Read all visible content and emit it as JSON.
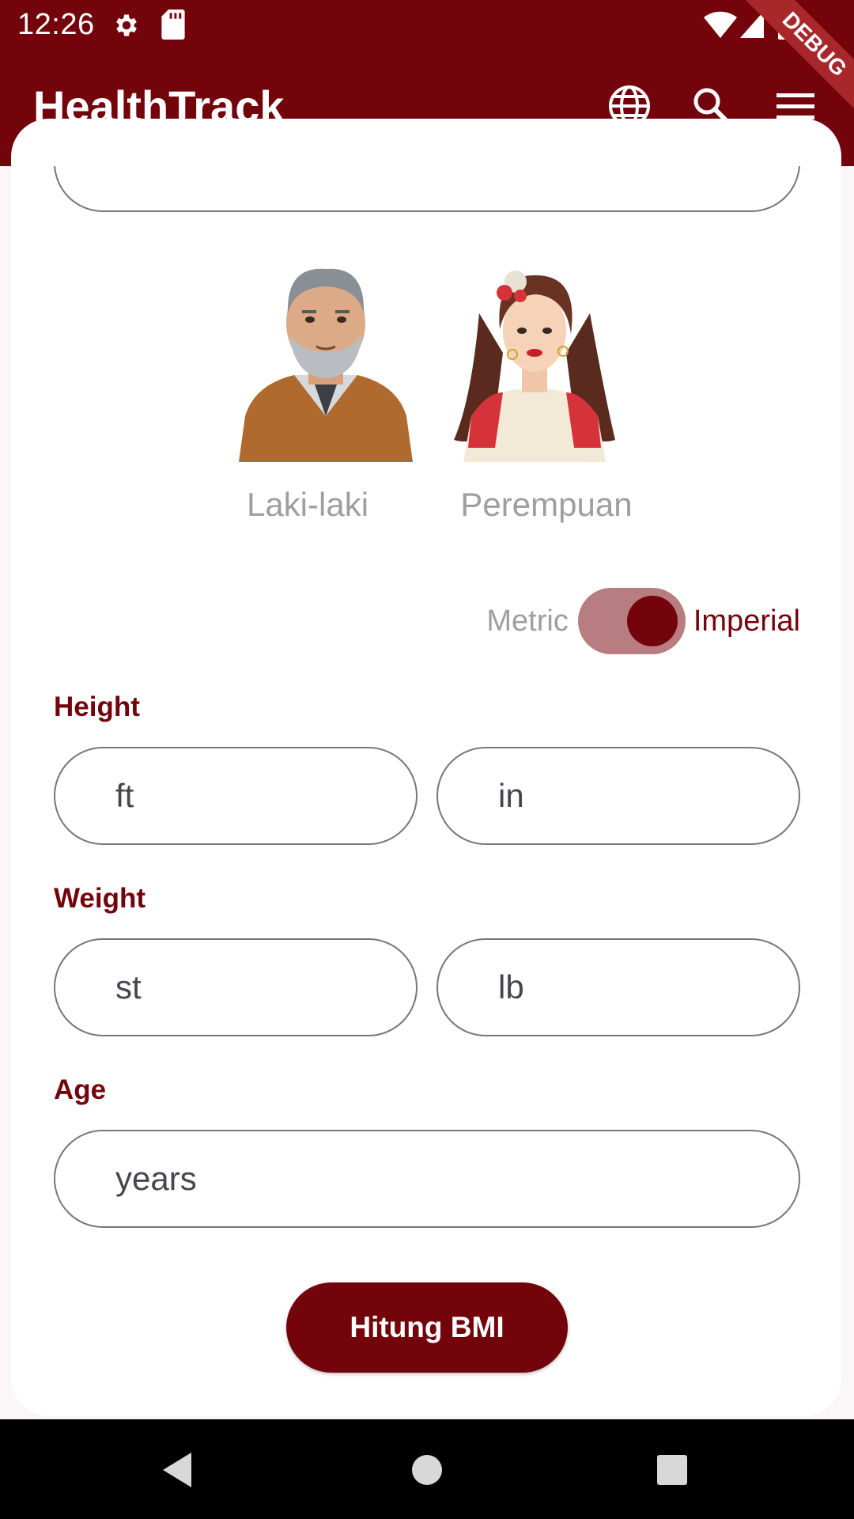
{
  "status_bar": {
    "time": "12:26"
  },
  "app_bar": {
    "title": "HealthTrack"
  },
  "debug_banner": "DEBUG",
  "gender": {
    "male_label": "Laki-laki",
    "female_label": "Perempuan"
  },
  "units": {
    "metric_label": "Metric",
    "imperial_label": "Imperial",
    "selected": "Imperial"
  },
  "form": {
    "height_label": "Height",
    "height_ft_placeholder": "ft",
    "height_in_placeholder": "in",
    "weight_label": "Weight",
    "weight_st_placeholder": "st",
    "weight_lb_placeholder": "lb",
    "age_label": "Age",
    "age_placeholder": "years",
    "submit_label": "Hitung BMI"
  },
  "colors": {
    "primary": "#74040c",
    "switch_track": "#b87d80",
    "muted_text": "#9e9e9e",
    "outline": "#79747e"
  },
  "icons": {
    "status": [
      "gear-icon",
      "sd-card-icon",
      "wifi-icon",
      "signal-icon",
      "battery-icon"
    ],
    "app_bar": [
      "globe-icon",
      "search-icon",
      "menu-icon"
    ],
    "nav": [
      "back-icon",
      "home-icon",
      "recents-icon"
    ]
  }
}
